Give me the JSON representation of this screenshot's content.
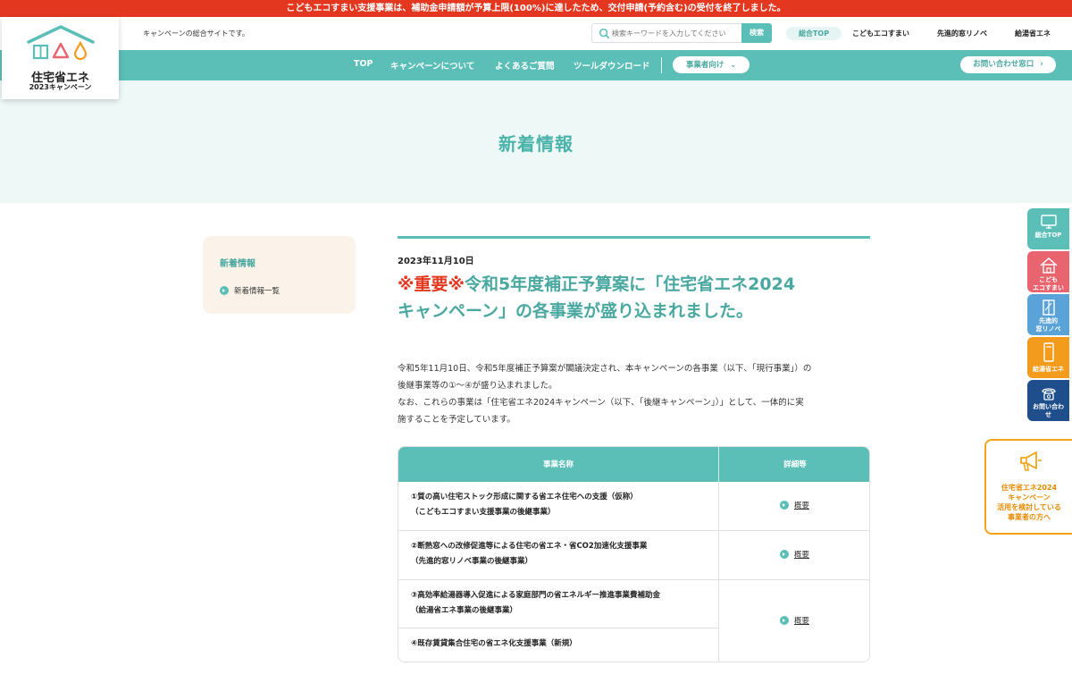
{
  "alert": {
    "text": "こどもエコすまい支援事業は、補助金申請額が予算上限(100%)に達したため、交付申請(予約含む)の受付を終了しました。"
  },
  "logo": {
    "main": "住宅省エネ",
    "sub": "2023キャンペーン"
  },
  "header": {
    "tagline": "キャンペーンの総合サイトです。",
    "search_placeholder": "検索キーワードを入力してください",
    "search_button": "検索",
    "links": [
      "総合TOP",
      "こどもエコすまい",
      "先進的窓リノベ",
      "給湯省エネ"
    ]
  },
  "nav": {
    "items": [
      "TOP",
      "キャンペーンについて",
      "よくあるご質問",
      "ツールダウンロード"
    ],
    "business_pill": "事業者向け",
    "contact_pill": "お問い合わせ窓口"
  },
  "hero": {
    "title": "新着情報"
  },
  "sidebar": {
    "heading": "新着情報",
    "link": "新着情報一覧"
  },
  "article": {
    "date": "2023年11月10日",
    "title_important": "※重要※",
    "title_line1_rest": "令和5年度補正予算案に「住宅省エネ2024",
    "title_line2": "キャンペーン」の各事業が盛り込まれました。",
    "body": [
      "令和5年11月10日、令和5年度補正予算案が閣議決定され、本キャンペーンの各事業（以下、「現行事業」）の",
      "後継事業等の①～④が盛り込まれました。",
      "なお、これらの事業は「住宅省エネ2024キャンペーン（以下、「後継キャンペーン」）」として、一体的に実",
      "施することを予定しています。"
    ]
  },
  "table": {
    "headers": [
      "事業名称",
      "詳細等"
    ],
    "rows": [
      {
        "line1": "①質の高い住宅ストック形成に関する省エネ住宅への支援（仮称）",
        "line2": "（こどもエコすまい支援事業の後継事業）"
      },
      {
        "line1": "②断熱窓への改修促進等による住宅の省エネ・省CO2加速化支援事業",
        "line2": "（先進的窓リノベ事業の後継事業）"
      },
      {
        "line1": "③高効率給湯器導入促進による家庭部門の省エネルギー推進事業費補助金",
        "line2": "（給湯省エネ事業の後継事業）"
      },
      {
        "line1": "④既存賃貸集合住宅の省エネ化支援事業（新規）",
        "line2": ""
      }
    ],
    "detail_link": "概要"
  },
  "side_tabs": [
    {
      "label1": "総合TOP",
      "label2": "",
      "color": "#5bbfb7"
    },
    {
      "label1": "こども",
      "label2": "エコすまい",
      "color": "#e8646f"
    },
    {
      "label1": "先進的",
      "label2": "窓リノベ",
      "color": "#5aa3d9"
    },
    {
      "label1": "給湯省エネ",
      "label2": "",
      "color": "#f39b1c"
    },
    {
      "label1": "お問い合わ",
      "label2": "せ",
      "color": "#1e4e8c"
    }
  ],
  "promo": {
    "lines": [
      "住宅省エネ2024",
      "キャンペーン",
      "活用を検討している",
      "事業者の方へ"
    ]
  },
  "colors": {
    "teal": "#5bbfb7",
    "red": "#e4371f",
    "orange": "#f3a418"
  }
}
